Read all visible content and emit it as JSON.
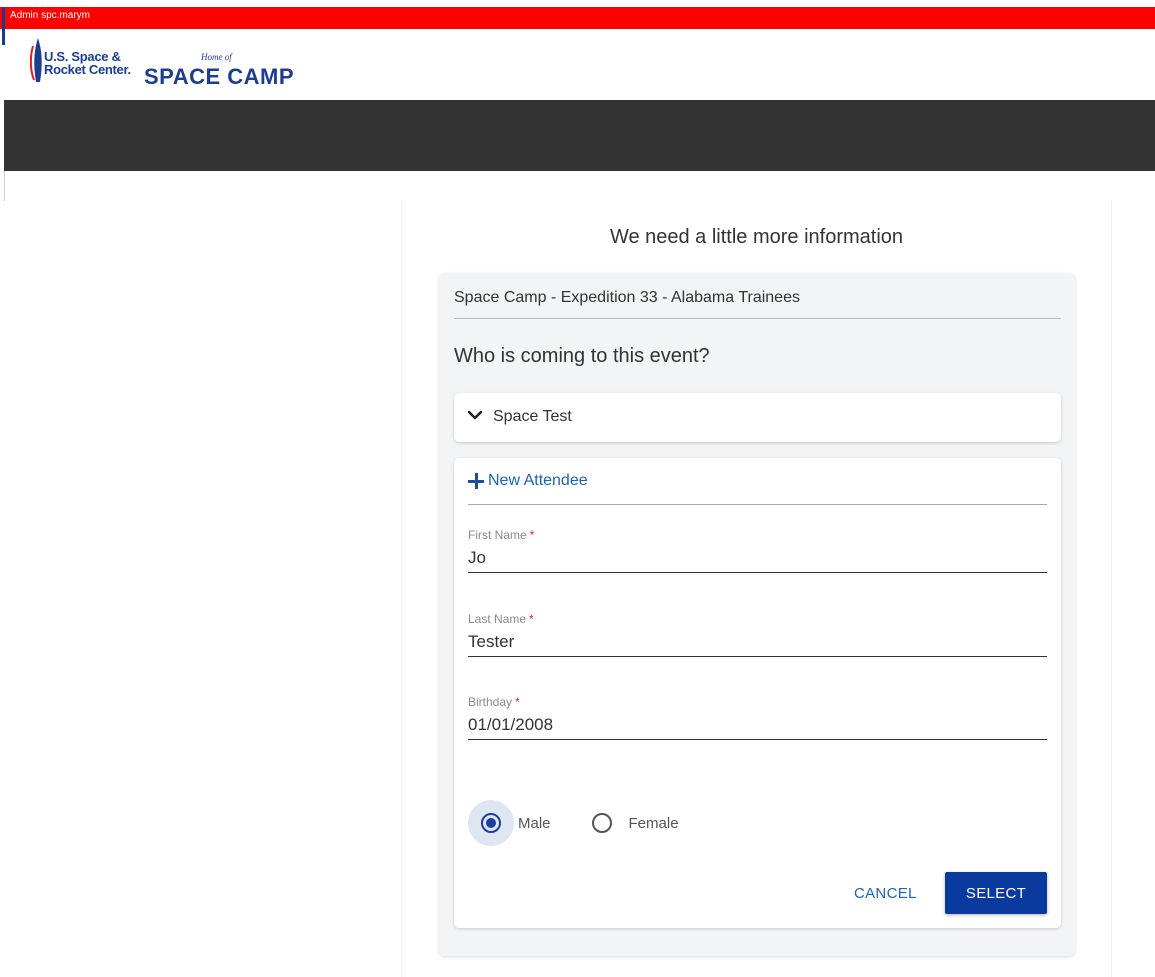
{
  "admin_bar": {
    "text": "Admin spc.marym"
  },
  "brand": {
    "ussrc_line1": "U.S. Space &",
    "ussrc_line2": "Rocket Center.",
    "home_of": "Home of",
    "space_camp": "SPACE CAMP"
  },
  "colors": {
    "admin_bar": "#ff0000",
    "nav_bar": "#333333",
    "brand_blue": "#1d3d8f",
    "primary_button": "#0b3a9e",
    "link": "#1d63b5"
  },
  "page": {
    "heading": "We need a little more information",
    "event_name": "Space Camp - Expedition 33 - Alabama Trainees",
    "question": "Who is coming to this event?"
  },
  "attendee": {
    "name": "Space Test",
    "icon": "chevron-down-icon"
  },
  "form": {
    "new_attendee_label": "New Attendee",
    "new_attendee_icon": "plus-icon",
    "first_name": {
      "label": "First Name",
      "required": "*",
      "value": "Jo"
    },
    "last_name": {
      "label": "Last Name",
      "required": "*",
      "value": "Tester"
    },
    "birthday": {
      "label": "Birthday",
      "required": "*",
      "value": "01/01/2008"
    },
    "gender": {
      "options": [
        "Male",
        "Female"
      ],
      "selected": "Male"
    },
    "cancel_label": "CANCEL",
    "select_label": "SELECT"
  }
}
